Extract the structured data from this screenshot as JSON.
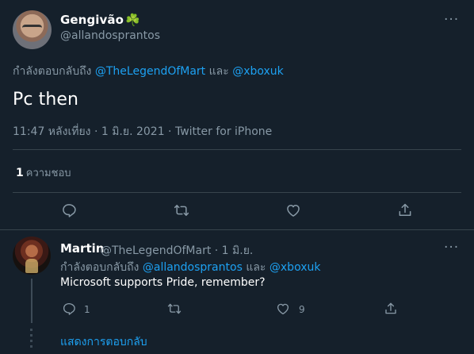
{
  "main_tweet": {
    "display_name": "Gengivão",
    "name_emoji": "☘️",
    "handle": "@allandosprantos",
    "replying_prefix": "กำลังตอบกลับถึง",
    "reply_to_1": "@TheLegendOfMart",
    "reply_and": "และ",
    "reply_to_2": "@xboxuk",
    "text": "Pc then",
    "meta": "11:47 หลังเที่ยง · 1 มิ.ย. 2021 · Twitter for iPhone",
    "likes_count": "1",
    "likes_label": "ความชอบ",
    "actions": {
      "reply_icon": "reply-icon",
      "retweet_icon": "retweet-icon",
      "like_icon": "heart-icon",
      "share_icon": "share-icon"
    }
  },
  "reply_tweet": {
    "display_name": "Martin",
    "handle_date": "@TheLegendOfMart · 1 มิ.ย.",
    "replying_prefix": "กำลังตอบกลับถึง",
    "reply_to_1": "@allandosprantos",
    "reply_and": "และ",
    "reply_to_2": "@xboxuk",
    "text": "Microsoft supports Pride, remember?",
    "reply_count": "1",
    "like_count": "9"
  },
  "show_replies": "แสดงการตอบกลับ",
  "more_glyph": "···",
  "colors": {
    "background": "#15202b",
    "accent": "#1da1f2",
    "secondary_text": "#8899a6",
    "divider": "#38444d"
  }
}
